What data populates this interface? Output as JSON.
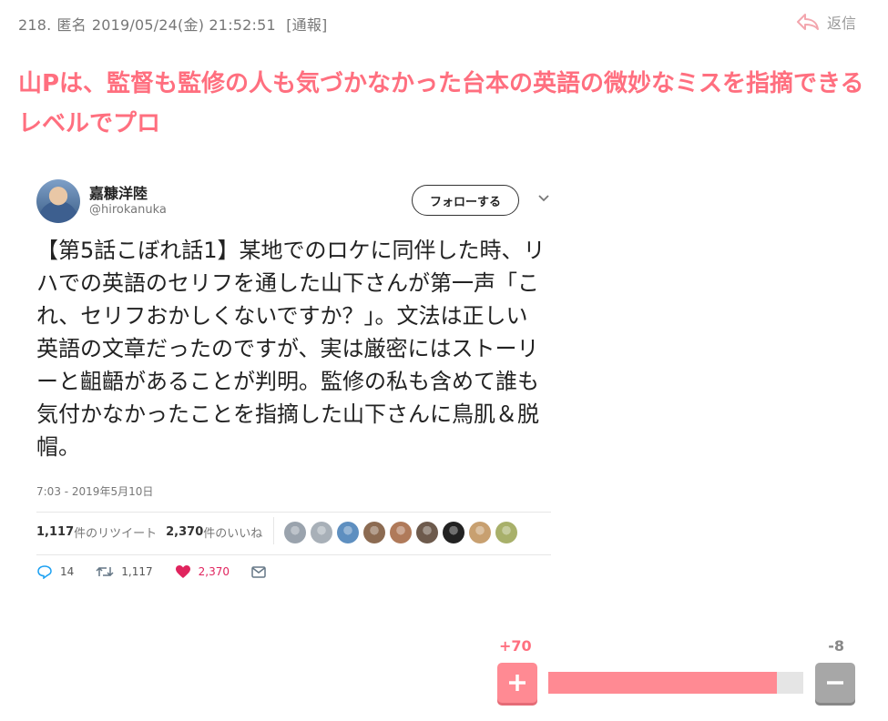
{
  "comment": {
    "number": "218.",
    "author": "匿名",
    "datetime": "2019/05/24(金) 21:52:51",
    "report_label": "[通報]",
    "reply_label": "返信",
    "headline": "山Pは、監督も監修の人も気づかなかった台本の英語の微妙なミスを指摘できるレベルでプロ"
  },
  "tweet": {
    "name": "嘉糠洋陸",
    "handle": "@hirokanuka",
    "follow_label": "フォローする",
    "text": "【第5話こぼれ話1】某地でのロケに同伴した時、リハでの英語のセリフを通した山下さんが第一声「これ、セリフおかしくないですか？」。文法は正しい英語の文章だったのですが、実は厳密にはストーリーと齟齬があることが判明。監修の私も含めて誰も気付かなかったことを指摘した山下さんに鳥肌＆脱帽。",
    "timestamp": "7:03 - 2019年5月10日",
    "retweet_count": "1,117",
    "retweet_label": "件のリツイート",
    "like_count": "2,370",
    "like_label": "件のいいね",
    "actions": {
      "reply": "14",
      "retweet": "1,117",
      "like": "2,370"
    },
    "liker_avatar_colors": [
      "#9aa3ad",
      "#a8b0b8",
      "#5e8fc0",
      "#8c6b52",
      "#b07a5a",
      "#6d5a4c",
      "#222222",
      "#c8a070",
      "#a8b06a"
    ]
  },
  "vote": {
    "plus": "+70",
    "minus": "-8",
    "ratio": 0.897,
    "plus_color": "#ff8a93",
    "minus_color": "#a7a7a7"
  }
}
